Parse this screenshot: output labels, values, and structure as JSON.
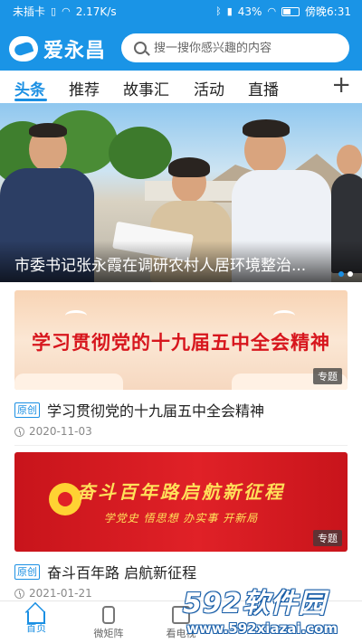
{
  "status_bar": {
    "carrier": "未插卡",
    "network_speed": "2.17K/s",
    "battery": "43%",
    "time": "傍晚6:31"
  },
  "header": {
    "app_name": "爱永昌",
    "search_placeholder": "搜一搜你感兴趣的内容"
  },
  "tabs": [
    {
      "label": "头条",
      "active": true
    },
    {
      "label": "推荐",
      "active": false
    },
    {
      "label": "故事汇",
      "active": false
    },
    {
      "label": "活动",
      "active": false
    },
    {
      "label": "直播",
      "active": false
    }
  ],
  "tab_add_label": "+",
  "hero": {
    "caption": "市委书记张永霞在调研农村人居环境整治..."
  },
  "news": [
    {
      "banner_title": "学习贯彻党的十九届五中全会精神",
      "topic_tag": "专题",
      "origin_tag": "原创",
      "title": "学习贯彻党的十九届五中全会精神",
      "date": "2020-11-03"
    },
    {
      "banner_title": "奋斗百年路启航新征程",
      "banner_subtitle": "学党史 悟思想 办实事 开新局",
      "topic_tag": "专题",
      "origin_tag": "原创",
      "title": "奋斗百年路 启航新征程",
      "date": "2021-01-21"
    }
  ],
  "bottom_nav": [
    {
      "label": "首页",
      "icon": "home-icon",
      "active": true
    },
    {
      "label": "微矩阵",
      "icon": "phone-icon",
      "active": false
    },
    {
      "label": "看电视",
      "icon": "tv-icon",
      "active": false
    }
  ],
  "watermark": {
    "logo": "592软件园",
    "url": "www.592xiazai.com"
  },
  "colors": {
    "brand_blue": "#1a94e6",
    "accent_red": "#d7161d"
  }
}
